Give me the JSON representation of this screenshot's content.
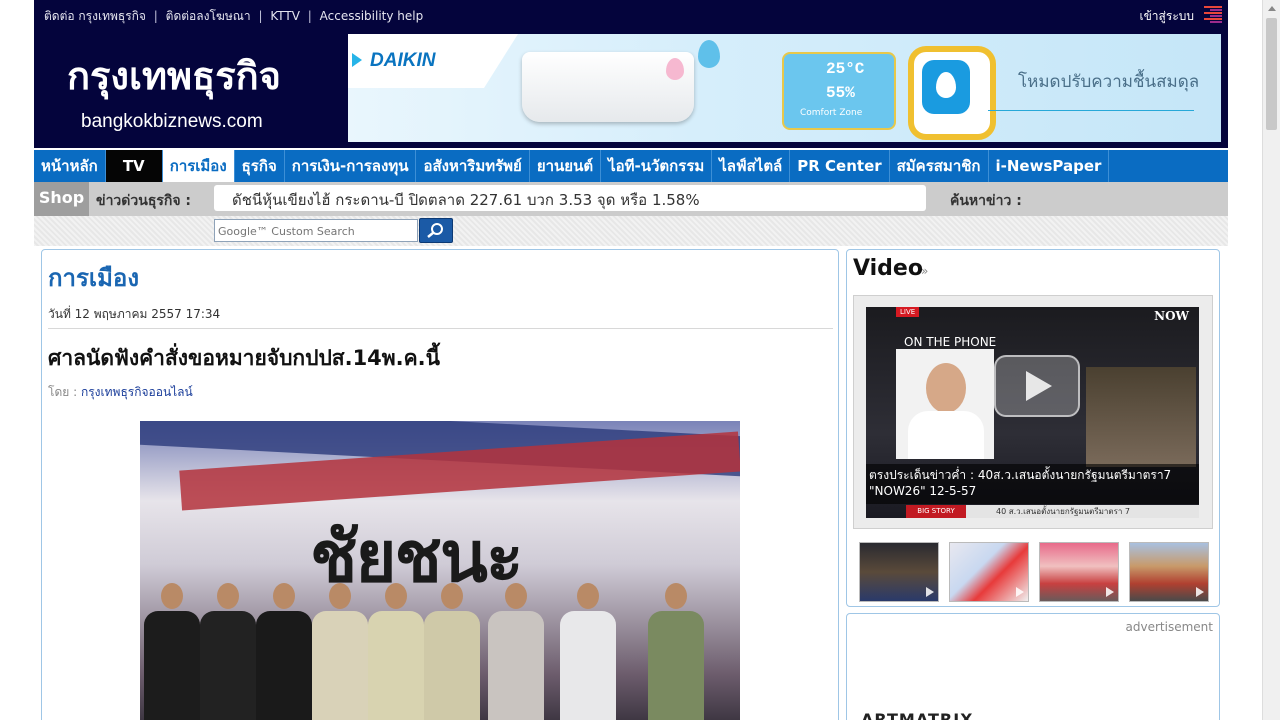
{
  "topbar": {
    "links": [
      "ติดต่อ กรุงเทพธุรกิจ",
      "ติดต่อลงโฆษณา",
      "KTTV",
      "Accessibility help"
    ],
    "separator": "|",
    "login": "เข้าสู่ระบบ"
  },
  "header": {
    "logo_thai": "กรุงเทพธุรกิจ",
    "logo_url": "bangkokbiznews.com"
  },
  "banner": {
    "brand": "DAIKIN",
    "temp": "25°C",
    "humidity": "55%",
    "zone": "Comfort Zone",
    "tagline": "โหมดปรับความชื้นสมดุล"
  },
  "nav": {
    "items": [
      "หน้าหลัก",
      "TV",
      "การเมือง",
      "ธุรกิจ",
      "การเงิน-การลงทุน",
      "อสังหาริมทรัพย์",
      "ยานยนต์",
      "ไอที-นวัตกรรม",
      "ไลฟ์สไตล์",
      "PR Center",
      "สมัครสมาชิก",
      "i-NewsPaper"
    ],
    "active": "การเมือง"
  },
  "ticker": {
    "shop": "Shop",
    "label": "ข่าวด่วนธุรกิจ :",
    "text": "ดัชนีหุ้นเขียงไฮ้ กระดาน-บี ปิดตลาด 227.61 บวก 3.53 จุด หรือ 1.58%",
    "search_label": "ค้นหาข่าว :"
  },
  "search": {
    "placeholder": "Google™ Custom Search"
  },
  "article": {
    "section": "การเมือง",
    "date": "วันที่ 12 พฤษภาคม 2557 17:34",
    "headline": "ศาลนัดฟังคำสั่งขอหมายจับกปปส.14พ.ค.นี้",
    "by_label": "โดย :",
    "author": "กรุงเทพธุรกิจออนไลน์"
  },
  "video": {
    "title": "Video",
    "live": "LIVE",
    "now": "NOW",
    "on_phone": "ON THE PHONE",
    "caption": "ตรงประเด็นข่าวค่ำ : 40ส.ว.เสนอตั้งนายกรัฐมนตรีมาตรา7 \"NOW26\" 12-5-57",
    "big_story": "BIG STORY",
    "strip": "40 ส.ว.เสนอตั้งนายกรัฐมนตรีมาตรา 7"
  },
  "ad": {
    "label": "advertisement",
    "brand": "ARTMATRIX"
  },
  "colors": {
    "navy": "#04043c",
    "nav_blue": "#0a6cc2",
    "section_blue": "#1a66b2",
    "panel_border": "#9fc6e6"
  }
}
